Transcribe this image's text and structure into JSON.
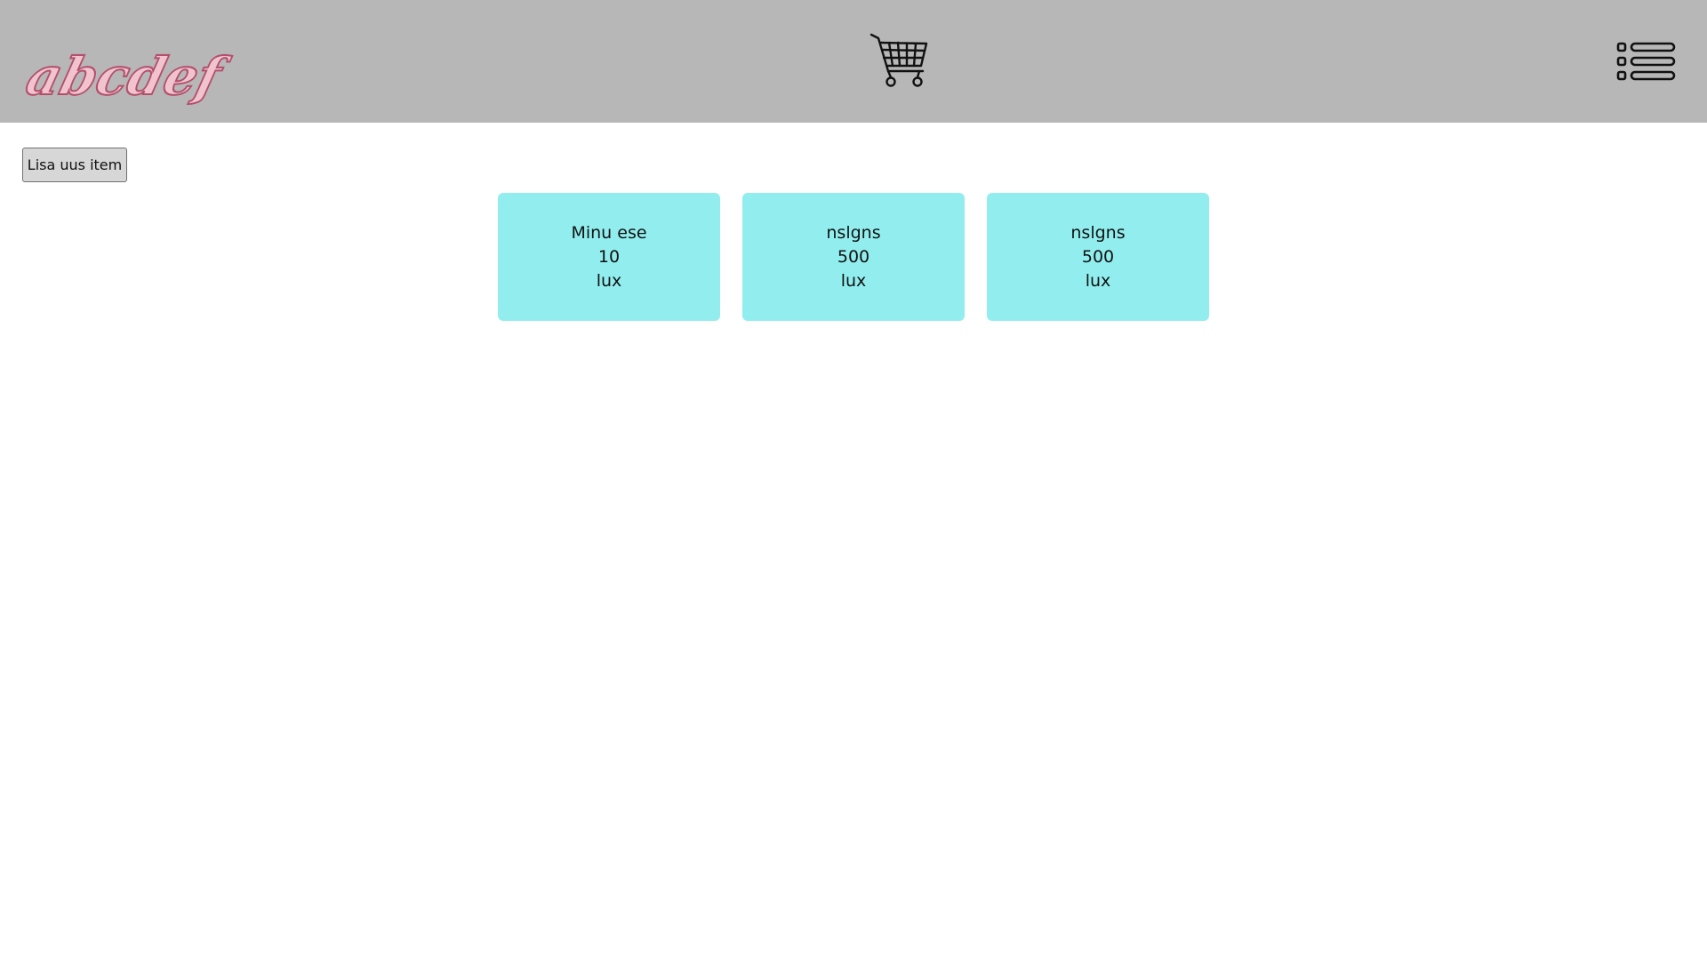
{
  "header": {
    "logo_text": "abcdef",
    "cart_icon": "shopping-cart-icon",
    "menu_icon": "list-menu-icon",
    "background_color": "#b7b7b7"
  },
  "main": {
    "add_button_label": "Lisa uus item",
    "items": [
      {
        "name": "Minu ese",
        "price": "10",
        "unit": "lux"
      },
      {
        "name": "nslgns",
        "price": "500",
        "unit": "lux"
      },
      {
        "name": "nslgns",
        "price": "500",
        "unit": "lux"
      }
    ],
    "card_color": "#92eeee"
  }
}
